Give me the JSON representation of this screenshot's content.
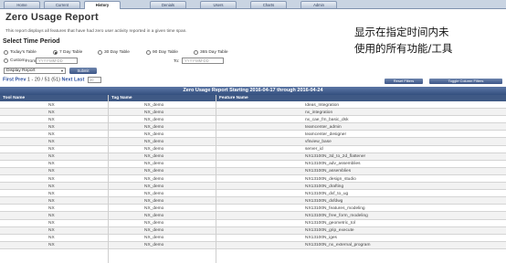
{
  "tabs": [
    {
      "label": "Home",
      "active": false
    },
    {
      "label": "Current",
      "active": false
    },
    {
      "label": "History",
      "active": true
    },
    {
      "label": "Denials",
      "active": false
    },
    {
      "label": "Users",
      "active": false
    },
    {
      "label": "Charts",
      "active": false
    },
    {
      "label": "Admin",
      "active": false
    }
  ],
  "report": {
    "title": "Zero Usage Report",
    "description": "This report displays all features that have had zero user activity reported in a given time span."
  },
  "time_select": {
    "heading": "Select Time Period",
    "options": [
      {
        "label": "Today's Table",
        "checked": false
      },
      {
        "label": "7 Day Table",
        "checked": true
      },
      {
        "label": "30 Day Table",
        "checked": false
      },
      {
        "label": "90 Day Table",
        "checked": false
      },
      {
        "label": "365 Day Table",
        "checked": false
      }
    ],
    "custom": {
      "label": "Custom:",
      "from_label": "From:",
      "from_placeholder": "YYYY-MM-DD",
      "to_label": "To:",
      "to_placeholder": "YYYY-MM-DD"
    }
  },
  "display": {
    "selected": "Display Report",
    "submit_label": "Submit"
  },
  "pager": {
    "first": "First",
    "prev": "Prev",
    "range": "1 - 20 / 51 (51)",
    "next": "Next",
    "last": "Last",
    "page_size": "20"
  },
  "buttons": {
    "reset_filters": "Reset Filters",
    "toggle_filters": "Toggle Column Filters"
  },
  "overlay_text": [
    "显示在指定时间内未",
    "使用的所有功能/工具"
  ],
  "table": {
    "banner": "Zero Usage Report Starting 2016-04-17 through 2016-04-24",
    "columns": [
      "Tool Name",
      "Tag Name",
      "Feature Name"
    ],
    "rows": [
      [
        "NX",
        "NX_demo",
        "Ideas_Integration"
      ],
      [
        "NX",
        "NX_demo",
        "nx_integration"
      ],
      [
        "NX",
        "NX_demo",
        "nx_cae_fm_basic_dsk"
      ],
      [
        "NX",
        "NX_demo",
        "teamcenter_admin"
      ],
      [
        "NX",
        "NX_demo",
        "teamcenter_designer"
      ],
      [
        "NX",
        "NX_demo",
        "vfsview_base"
      ],
      [
        "NX",
        "NX_demo",
        "server_id"
      ],
      [
        "NX",
        "NX_demo",
        "NX13100N_3d_to_2d_flattener"
      ],
      [
        "NX",
        "NX_demo",
        "NX13100N_adv_assemblies"
      ],
      [
        "NX",
        "NX_demo",
        "NX13100N_assemblies"
      ],
      [
        "NX",
        "NX_demo",
        "NX13100N_design_studio"
      ],
      [
        "NX",
        "NX_demo",
        "NX13100N_drafting"
      ],
      [
        "NX",
        "NX_demo",
        "NX13100N_dxf_to_ug"
      ],
      [
        "NX",
        "NX_demo",
        "NX13100N_dxfdwg"
      ],
      [
        "NX",
        "NX_demo",
        "NX13100N_features_modeling"
      ],
      [
        "NX",
        "NX_demo",
        "NX13100N_free_form_modeling"
      ],
      [
        "NX",
        "NX_demo",
        "NX13100N_geometric_tol"
      ],
      [
        "NX",
        "NX_demo",
        "NX13100N_grip_execute"
      ],
      [
        "NX",
        "NX_demo",
        "NX13100N_iges"
      ],
      [
        "NX",
        "NX_demo",
        "NX13100N_nx_external_program"
      ]
    ]
  }
}
